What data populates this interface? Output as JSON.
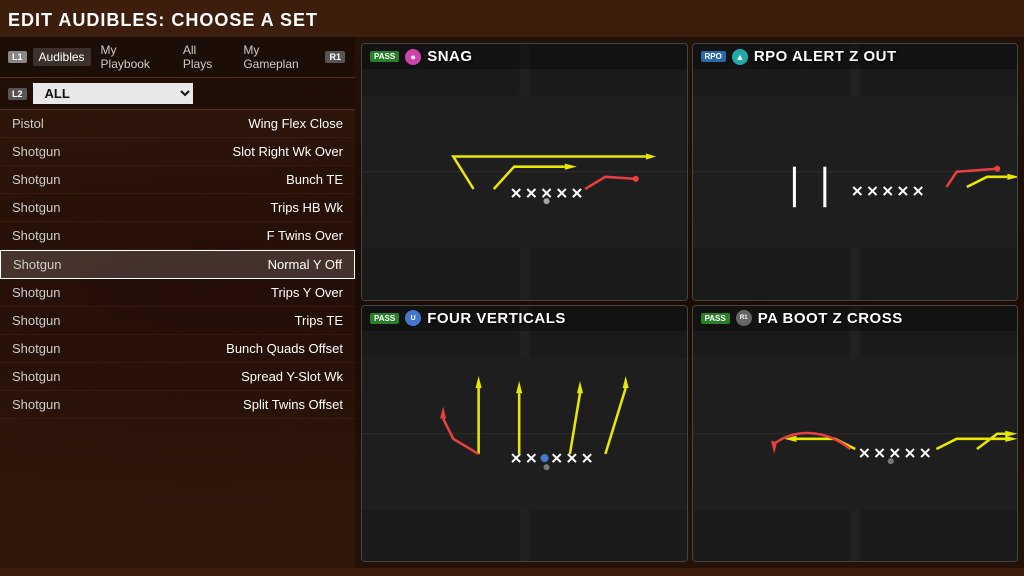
{
  "page": {
    "title": "EDIT AUDIBLES: CHOOSE A SET"
  },
  "tabs": {
    "left_badge": "L1",
    "right_badge": "R1",
    "items": [
      {
        "label": "Audibles",
        "active": true
      },
      {
        "label": "My Playbook",
        "active": false
      },
      {
        "label": "All Plays",
        "active": false
      },
      {
        "label": "My Gameplan",
        "active": false
      }
    ]
  },
  "filter": {
    "badge": "L2",
    "value": "ALL"
  },
  "play_list": [
    {
      "formation": "Pistol",
      "play": "Wing Flex Close",
      "selected": false
    },
    {
      "formation": "Shotgun",
      "play": "Slot Right Wk Over",
      "selected": false
    },
    {
      "formation": "Shotgun",
      "play": "Bunch TE",
      "selected": false
    },
    {
      "formation": "Shotgun",
      "play": "Trips HB Wk",
      "selected": false
    },
    {
      "formation": "Shotgun",
      "play": "F Twins Over",
      "selected": false
    },
    {
      "formation": "Shotgun",
      "play": "Normal Y Off",
      "selected": true
    },
    {
      "formation": "Shotgun",
      "play": "Trips Y Over",
      "selected": false
    },
    {
      "formation": "Shotgun",
      "play": "Trips TE",
      "selected": false
    },
    {
      "formation": "Shotgun",
      "play": "Bunch Quads Offset",
      "selected": false
    },
    {
      "formation": "Shotgun",
      "play": "Spread Y-Slot Wk",
      "selected": false
    },
    {
      "formation": "Shotgun",
      "play": "Split Twins Offset",
      "selected": false
    }
  ],
  "play_cards": [
    {
      "id": "snag",
      "type": "PASS",
      "type_class": "pass",
      "icon_class": "pink",
      "icon_label": "●",
      "title": "SNAG",
      "position": "top-left"
    },
    {
      "id": "rpo_alert",
      "type": "RPO",
      "type_class": "rpo",
      "icon_class": "teal",
      "icon_label": "▲",
      "title": "RPO ALERT Z OUT",
      "position": "top-right"
    },
    {
      "id": "four_verticals",
      "type": "PASS",
      "type_class": "pass",
      "icon_class": "blue-circle",
      "icon_label": "U",
      "title": "FOUR VERTICALS",
      "position": "bottom-left"
    },
    {
      "id": "pa_boot",
      "type": "PASS",
      "type_class": "pass",
      "icon_class": "gray-circle",
      "icon_label": "R1",
      "title": "PA BOOT Z CROSS",
      "position": "bottom-right"
    }
  ]
}
